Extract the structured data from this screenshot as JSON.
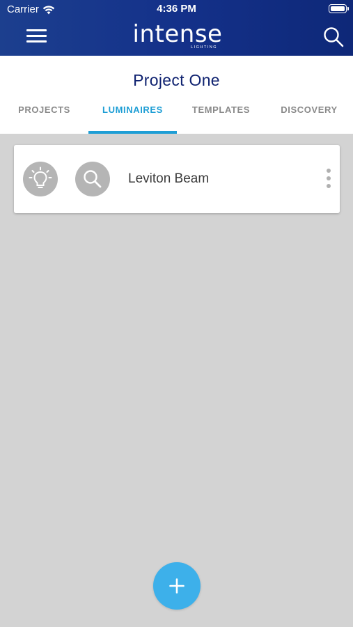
{
  "status_bar": {
    "carrier": "Carrier",
    "time": "4:36 PM"
  },
  "nav": {
    "logo_word": "intense",
    "logo_sub": "LIGHTING",
    "menu_icon": "hamburger-icon",
    "search_icon": "search-icon"
  },
  "project": {
    "title": "Project One"
  },
  "tabs": [
    {
      "label": "PROJECTS",
      "active": false
    },
    {
      "label": "LUMINAIRES",
      "active": true
    },
    {
      "label": "TEMPLATES",
      "active": false
    },
    {
      "label": "DISCOVERY",
      "active": false
    }
  ],
  "luminaires": [
    {
      "name": "Leviton Beam",
      "icons": [
        "lightbulb-icon",
        "search-icon"
      ]
    }
  ],
  "fab": {
    "icon": "plus-icon"
  },
  "colors": {
    "header_bg": "#14318a",
    "title": "#0f2270",
    "accent": "#1e9ed5",
    "fab": "#3db0ea",
    "background": "#d3d3d3"
  }
}
